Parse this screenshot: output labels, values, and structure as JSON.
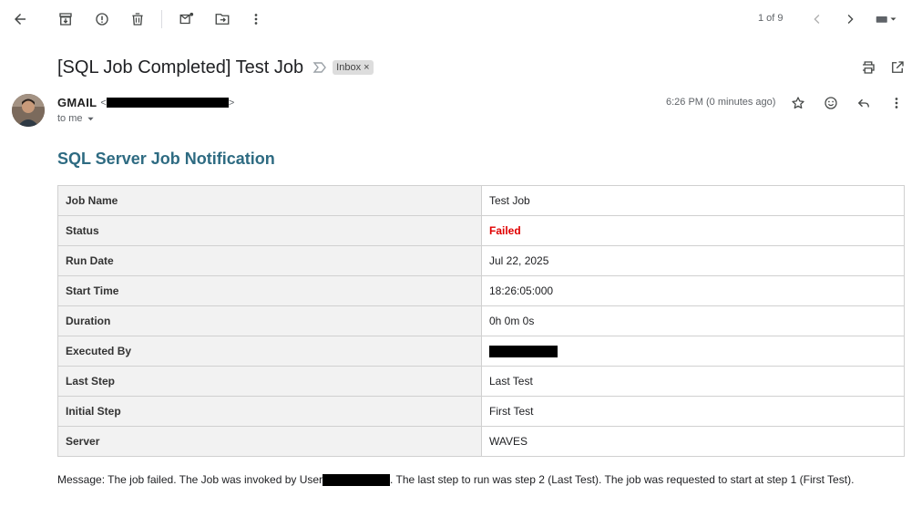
{
  "toolbar": {
    "icons": [
      "back-arrow-icon",
      "archive-icon",
      "report-spam-icon",
      "delete-icon",
      "mark-unread-icon",
      "move-to-icon",
      "more-vert-icon"
    ],
    "pager_text": "1 of 9",
    "input_tools_icon": "keyboard-icon"
  },
  "email": {
    "subject": "[SQL Job Completed] Test Job",
    "label": "Inbox",
    "label_close": "×",
    "sender_name": "GMAIL",
    "sender_email_open": "<",
    "sender_email_close": ">",
    "to_text": "to me",
    "timestamp": "6:26 PM (0 minutes ago)"
  },
  "notification": {
    "title": "SQL Server Job Notification",
    "rows": [
      {
        "key": "Job Name",
        "value": "Test Job"
      },
      {
        "key": "Status",
        "value": "Failed"
      },
      {
        "key": "Run Date",
        "value": "Jul 22, 2025"
      },
      {
        "key": "Start Time",
        "value": "18:26:05:000"
      },
      {
        "key": "Duration",
        "value": "0h 0m 0s"
      },
      {
        "key": "Executed By",
        "value": ""
      },
      {
        "key": "Last Step",
        "value": "Last Test"
      },
      {
        "key": "Initial Step",
        "value": "First Test"
      },
      {
        "key": "Server",
        "value": "WAVES"
      }
    ],
    "message_prefix": "Message: The job failed. The Job was invoked by User",
    "message_suffix": ". The last step to run was step 2 (Last Test). The job was requested to start at step 1 (First Test)."
  },
  "colors": {
    "title_color": "#2e6b82",
    "failed_color": "#e00000",
    "key_cell_bg": "#f2f2f2",
    "redaction": "#000000"
  }
}
